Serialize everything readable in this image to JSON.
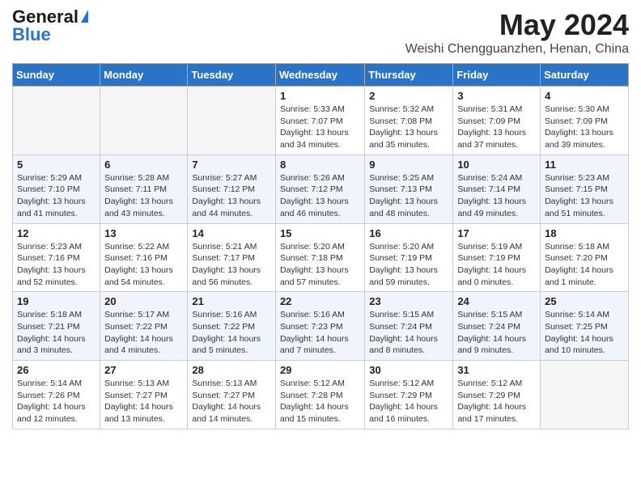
{
  "header": {
    "logo_general": "General",
    "logo_blue": "Blue",
    "month_year": "May 2024",
    "location": "Weishi Chengguanzhen, Henan, China"
  },
  "days_of_week": [
    "Sunday",
    "Monday",
    "Tuesday",
    "Wednesday",
    "Thursday",
    "Friday",
    "Saturday"
  ],
  "weeks": [
    [
      {
        "day": "",
        "sunrise": "",
        "sunset": "",
        "daylight": "",
        "empty": true
      },
      {
        "day": "",
        "sunrise": "",
        "sunset": "",
        "daylight": "",
        "empty": true
      },
      {
        "day": "",
        "sunrise": "",
        "sunset": "",
        "daylight": "",
        "empty": true
      },
      {
        "day": "1",
        "sunrise": "Sunrise: 5:33 AM",
        "sunset": "Sunset: 7:07 PM",
        "daylight": "Daylight: 13 hours and 34 minutes.",
        "empty": false
      },
      {
        "day": "2",
        "sunrise": "Sunrise: 5:32 AM",
        "sunset": "Sunset: 7:08 PM",
        "daylight": "Daylight: 13 hours and 35 minutes.",
        "empty": false
      },
      {
        "day": "3",
        "sunrise": "Sunrise: 5:31 AM",
        "sunset": "Sunset: 7:09 PM",
        "daylight": "Daylight: 13 hours and 37 minutes.",
        "empty": false
      },
      {
        "day": "4",
        "sunrise": "Sunrise: 5:30 AM",
        "sunset": "Sunset: 7:09 PM",
        "daylight": "Daylight: 13 hours and 39 minutes.",
        "empty": false
      }
    ],
    [
      {
        "day": "5",
        "sunrise": "Sunrise: 5:29 AM",
        "sunset": "Sunset: 7:10 PM",
        "daylight": "Daylight: 13 hours and 41 minutes.",
        "empty": false
      },
      {
        "day": "6",
        "sunrise": "Sunrise: 5:28 AM",
        "sunset": "Sunset: 7:11 PM",
        "daylight": "Daylight: 13 hours and 43 minutes.",
        "empty": false
      },
      {
        "day": "7",
        "sunrise": "Sunrise: 5:27 AM",
        "sunset": "Sunset: 7:12 PM",
        "daylight": "Daylight: 13 hours and 44 minutes.",
        "empty": false
      },
      {
        "day": "8",
        "sunrise": "Sunrise: 5:26 AM",
        "sunset": "Sunset: 7:12 PM",
        "daylight": "Daylight: 13 hours and 46 minutes.",
        "empty": false
      },
      {
        "day": "9",
        "sunrise": "Sunrise: 5:25 AM",
        "sunset": "Sunset: 7:13 PM",
        "daylight": "Daylight: 13 hours and 48 minutes.",
        "empty": false
      },
      {
        "day": "10",
        "sunrise": "Sunrise: 5:24 AM",
        "sunset": "Sunset: 7:14 PM",
        "daylight": "Daylight: 13 hours and 49 minutes.",
        "empty": false
      },
      {
        "day": "11",
        "sunrise": "Sunrise: 5:23 AM",
        "sunset": "Sunset: 7:15 PM",
        "daylight": "Daylight: 13 hours and 51 minutes.",
        "empty": false
      }
    ],
    [
      {
        "day": "12",
        "sunrise": "Sunrise: 5:23 AM",
        "sunset": "Sunset: 7:16 PM",
        "daylight": "Daylight: 13 hours and 52 minutes.",
        "empty": false
      },
      {
        "day": "13",
        "sunrise": "Sunrise: 5:22 AM",
        "sunset": "Sunset: 7:16 PM",
        "daylight": "Daylight: 13 hours and 54 minutes.",
        "empty": false
      },
      {
        "day": "14",
        "sunrise": "Sunrise: 5:21 AM",
        "sunset": "Sunset: 7:17 PM",
        "daylight": "Daylight: 13 hours and 56 minutes.",
        "empty": false
      },
      {
        "day": "15",
        "sunrise": "Sunrise: 5:20 AM",
        "sunset": "Sunset: 7:18 PM",
        "daylight": "Daylight: 13 hours and 57 minutes.",
        "empty": false
      },
      {
        "day": "16",
        "sunrise": "Sunrise: 5:20 AM",
        "sunset": "Sunset: 7:19 PM",
        "daylight": "Daylight: 13 hours and 59 minutes.",
        "empty": false
      },
      {
        "day": "17",
        "sunrise": "Sunrise: 5:19 AM",
        "sunset": "Sunset: 7:19 PM",
        "daylight": "Daylight: 14 hours and 0 minutes.",
        "empty": false
      },
      {
        "day": "18",
        "sunrise": "Sunrise: 5:18 AM",
        "sunset": "Sunset: 7:20 PM",
        "daylight": "Daylight: 14 hours and 1 minute.",
        "empty": false
      }
    ],
    [
      {
        "day": "19",
        "sunrise": "Sunrise: 5:18 AM",
        "sunset": "Sunset: 7:21 PM",
        "daylight": "Daylight: 14 hours and 3 minutes.",
        "empty": false
      },
      {
        "day": "20",
        "sunrise": "Sunrise: 5:17 AM",
        "sunset": "Sunset: 7:22 PM",
        "daylight": "Daylight: 14 hours and 4 minutes.",
        "empty": false
      },
      {
        "day": "21",
        "sunrise": "Sunrise: 5:16 AM",
        "sunset": "Sunset: 7:22 PM",
        "daylight": "Daylight: 14 hours and 5 minutes.",
        "empty": false
      },
      {
        "day": "22",
        "sunrise": "Sunrise: 5:16 AM",
        "sunset": "Sunset: 7:23 PM",
        "daylight": "Daylight: 14 hours and 7 minutes.",
        "empty": false
      },
      {
        "day": "23",
        "sunrise": "Sunrise: 5:15 AM",
        "sunset": "Sunset: 7:24 PM",
        "daylight": "Daylight: 14 hours and 8 minutes.",
        "empty": false
      },
      {
        "day": "24",
        "sunrise": "Sunrise: 5:15 AM",
        "sunset": "Sunset: 7:24 PM",
        "daylight": "Daylight: 14 hours and 9 minutes.",
        "empty": false
      },
      {
        "day": "25",
        "sunrise": "Sunrise: 5:14 AM",
        "sunset": "Sunset: 7:25 PM",
        "daylight": "Daylight: 14 hours and 10 minutes.",
        "empty": false
      }
    ],
    [
      {
        "day": "26",
        "sunrise": "Sunrise: 5:14 AM",
        "sunset": "Sunset: 7:26 PM",
        "daylight": "Daylight: 14 hours and 12 minutes.",
        "empty": false
      },
      {
        "day": "27",
        "sunrise": "Sunrise: 5:13 AM",
        "sunset": "Sunset: 7:27 PM",
        "daylight": "Daylight: 14 hours and 13 minutes.",
        "empty": false
      },
      {
        "day": "28",
        "sunrise": "Sunrise: 5:13 AM",
        "sunset": "Sunset: 7:27 PM",
        "daylight": "Daylight: 14 hours and 14 minutes.",
        "empty": false
      },
      {
        "day": "29",
        "sunrise": "Sunrise: 5:12 AM",
        "sunset": "Sunset: 7:28 PM",
        "daylight": "Daylight: 14 hours and 15 minutes.",
        "empty": false
      },
      {
        "day": "30",
        "sunrise": "Sunrise: 5:12 AM",
        "sunset": "Sunset: 7:29 PM",
        "daylight": "Daylight: 14 hours and 16 minutes.",
        "empty": false
      },
      {
        "day": "31",
        "sunrise": "Sunrise: 5:12 AM",
        "sunset": "Sunset: 7:29 PM",
        "daylight": "Daylight: 14 hours and 17 minutes.",
        "empty": false
      },
      {
        "day": "",
        "sunrise": "",
        "sunset": "",
        "daylight": "",
        "empty": true
      }
    ]
  ]
}
